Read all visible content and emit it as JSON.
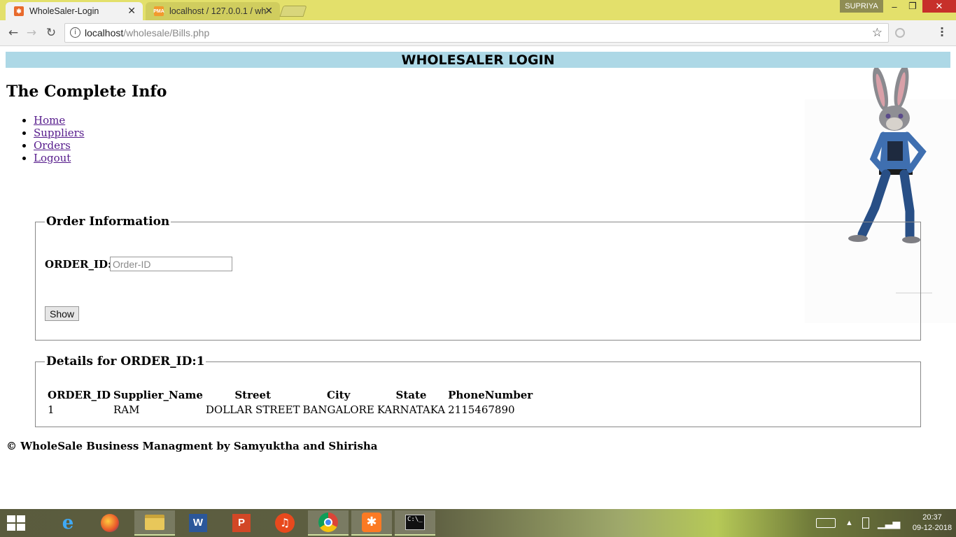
{
  "browser": {
    "tabs": [
      {
        "title": "WholeSaler-Login",
        "active": true
      },
      {
        "title": "localhost / 127.0.0.1 / wh",
        "active": false
      }
    ],
    "profile_name": "SUPRIYA",
    "address": {
      "host": "localhost",
      "path": "/wholesale/Bills.php"
    },
    "window_buttons": {
      "minimize": "–",
      "maximize": "❐",
      "close": "✕"
    }
  },
  "page": {
    "banner": "WHOLESALER LOGIN",
    "title": "The Complete Info",
    "nav": [
      "Home",
      "Suppliers",
      "Orders",
      "Logout"
    ],
    "order_form": {
      "legend": "Order Information",
      "label": "ORDER_ID:",
      "placeholder": "Order-ID",
      "value": "",
      "button": "Show"
    },
    "details": {
      "legend": "Details for ORDER_ID:1",
      "columns": [
        "ORDER_ID",
        "Supplier_Name",
        "Street",
        "City",
        "State",
        "PhoneNumber"
      ],
      "rows": [
        [
          "1",
          "RAM",
          "DOLLAR STREET",
          "BANGALORE",
          "KARNATAKA",
          "2115467890"
        ]
      ]
    },
    "footer": "© WholeSale Business Managment by Samyuktha and Shirisha"
  },
  "taskbar": {
    "apps": [
      "file-explorer-icon",
      "internet-explorer-icon",
      "firefox-icon",
      "file-manager-icon",
      "word-icon",
      "powerpoint-icon",
      "music-icon",
      "chrome-icon",
      "xampp-icon",
      "terminal-icon"
    ],
    "time": "20:37",
    "date": "09-12-2018"
  },
  "colors": {
    "chrome_frame": "#e3e06b",
    "banner_bg": "#add8e6",
    "link": "#551a8b",
    "close_button": "#c7302a"
  }
}
